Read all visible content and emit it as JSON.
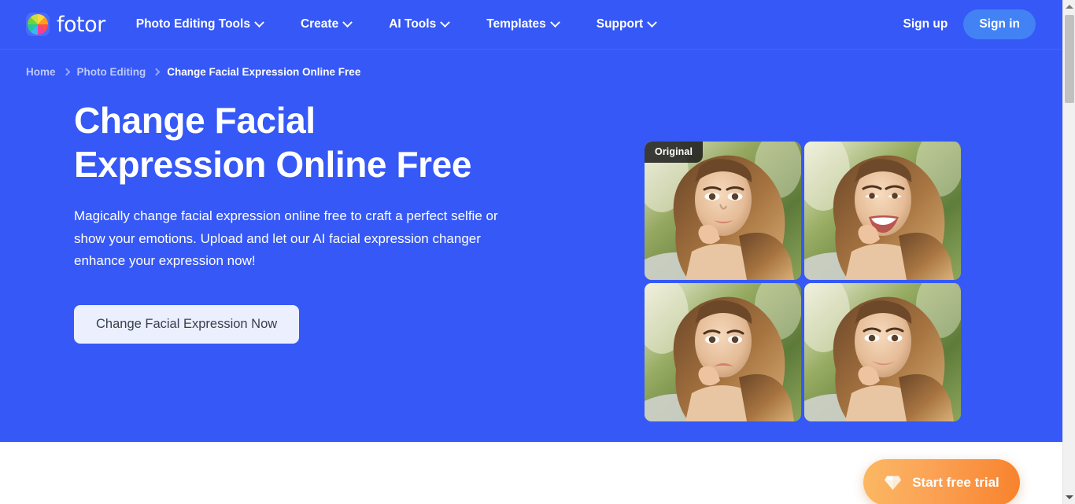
{
  "brand": {
    "name": "fotor",
    "logo_icon": "fotor-pinwheel-logo-icon",
    "primary_color": "#3558F6",
    "signin_color": "#4282F5",
    "cta_bg_color": "#ECEFFD",
    "cta_text_color": "#36404E",
    "trial_gradient_from": "#FBB863",
    "trial_gradient_to": "#F8822C"
  },
  "nav": {
    "items": [
      {
        "label": "Photo Editing Tools",
        "has_dropdown": true
      },
      {
        "label": "Create",
        "has_dropdown": true
      },
      {
        "label": "AI Tools",
        "has_dropdown": true
      },
      {
        "label": "Templates",
        "has_dropdown": true
      },
      {
        "label": "Support",
        "has_dropdown": true
      }
    ],
    "signup_label": "Sign up",
    "signin_label": "Sign in"
  },
  "breadcrumb": {
    "items": [
      {
        "label": "Home",
        "current": false
      },
      {
        "label": "Photo Editing",
        "current": false
      },
      {
        "label": "Change Facial Expression Online Free",
        "current": true
      }
    ],
    "separator_icon": "chevron-right-icon"
  },
  "hero": {
    "title": "Change Facial Expression Online Free",
    "description": "Magically change facial expression online free to craft a perfect selfie or show your emotions. Upload and let our AI facial expression changer enhance your expression now!",
    "cta_label": "Change Facial Expression Now"
  },
  "gallery": {
    "badge_label": "Original",
    "items": [
      {
        "alt": "Woman with neutral expression resting chin on hand",
        "expression": "neutral",
        "is_original": true
      },
      {
        "alt": "Woman with wide smiling expression",
        "expression": "smiling",
        "is_original": false
      },
      {
        "alt": "Woman with sad expression",
        "expression": "sad",
        "is_original": false
      },
      {
        "alt": "Woman with slight smile expression",
        "expression": "slight-smile",
        "is_original": false
      }
    ]
  },
  "floating_cta": {
    "label": "Start free trial",
    "icon": "diamond-gem-icon"
  },
  "scrollbar": {
    "up_icon": "triangle-up-icon",
    "down_icon": "triangle-down-icon",
    "thumb_label": "vertical-scroll-thumb"
  }
}
